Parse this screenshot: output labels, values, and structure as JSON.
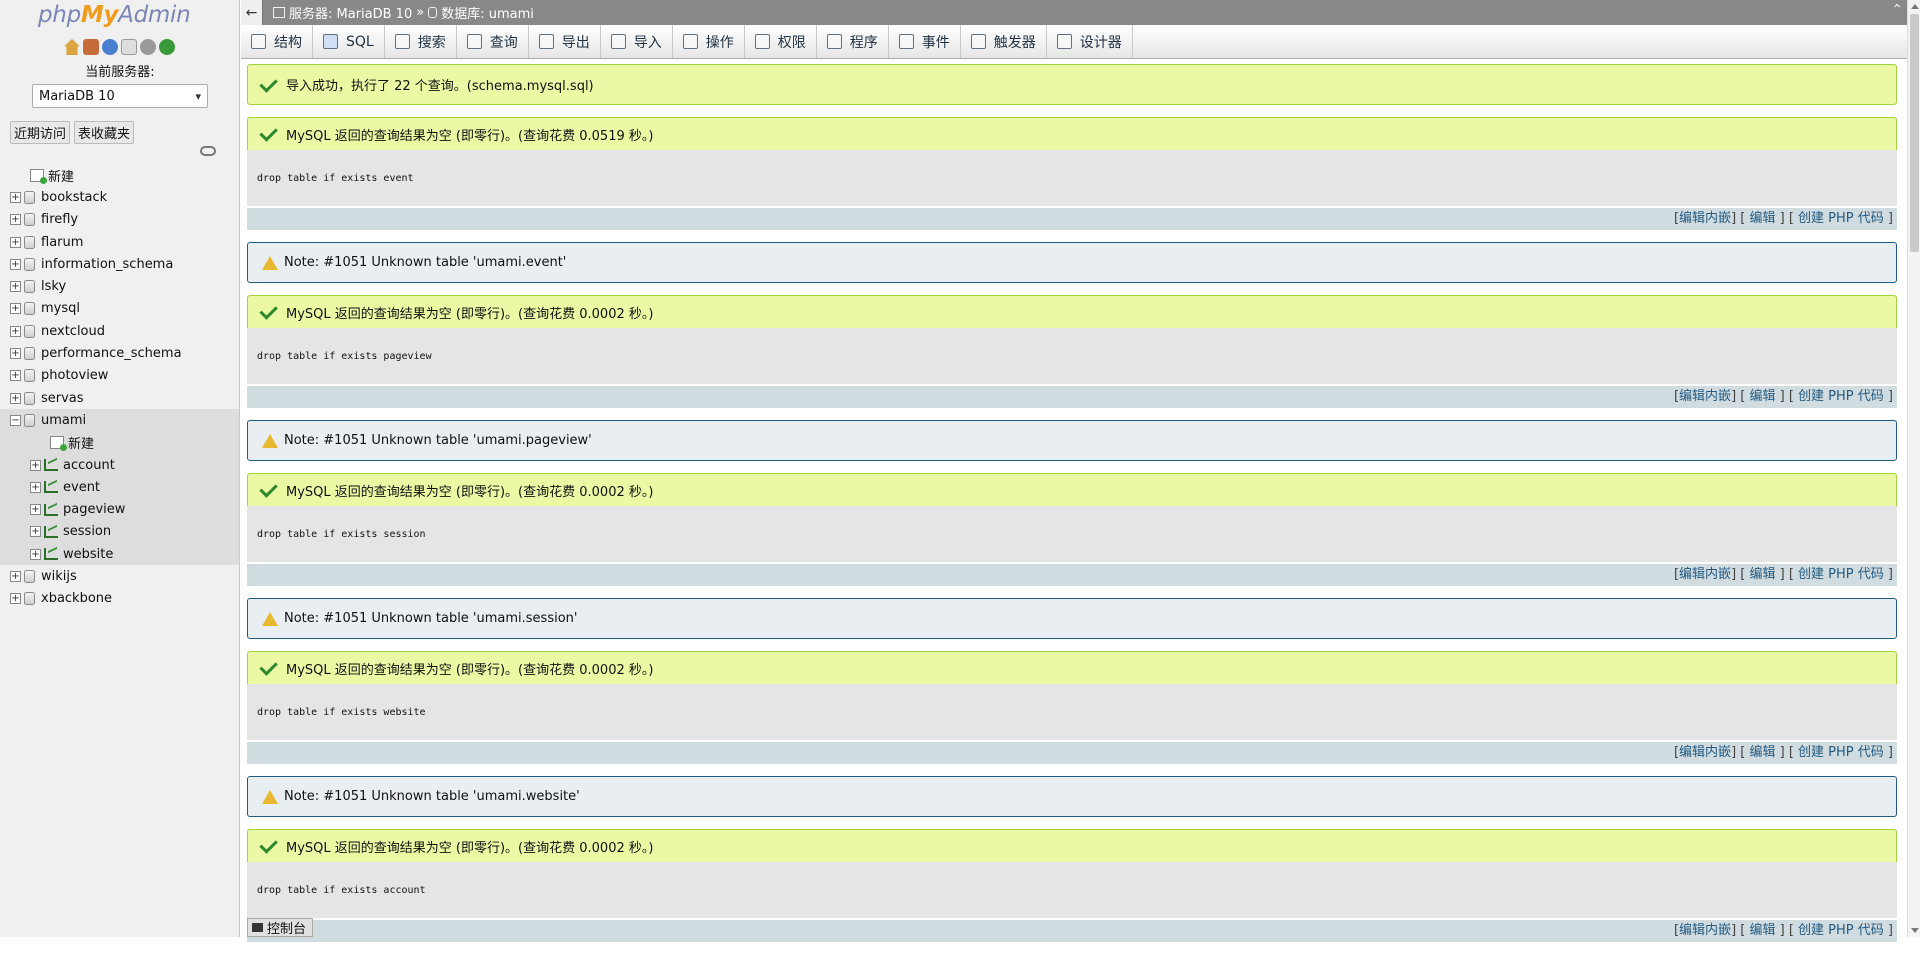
{
  "logo": {
    "php": "php",
    "my": "My",
    "admin": "Admin"
  },
  "sidebar": {
    "server_label": "当前服务器:",
    "server_value": "MariaDB 10",
    "tabs": [
      "近期访问",
      "表收藏夹"
    ],
    "tree": [
      {
        "label": "新建",
        "type": "new"
      },
      {
        "label": "bookstack",
        "type": "db"
      },
      {
        "label": "firefly",
        "type": "db"
      },
      {
        "label": "flarum",
        "type": "db"
      },
      {
        "label": "information_schema",
        "type": "db"
      },
      {
        "label": "lsky",
        "type": "db"
      },
      {
        "label": "mysql",
        "type": "db"
      },
      {
        "label": "nextcloud",
        "type": "db"
      },
      {
        "label": "performance_schema",
        "type": "db"
      },
      {
        "label": "photoview",
        "type": "db"
      },
      {
        "label": "servas",
        "type": "db"
      },
      {
        "label": "umami",
        "type": "db-open"
      },
      {
        "label": "新建",
        "type": "new-child"
      },
      {
        "label": "account",
        "type": "table"
      },
      {
        "label": "event",
        "type": "table"
      },
      {
        "label": "pageview",
        "type": "table"
      },
      {
        "label": "session",
        "type": "table"
      },
      {
        "label": "website",
        "type": "table"
      },
      {
        "label": "wikijs",
        "type": "db"
      },
      {
        "label": "xbackbone",
        "type": "db"
      }
    ]
  },
  "topbar": {
    "back_glyph": "←",
    "server_crumb": "服务器: MariaDB 10",
    "sep": "»",
    "db_crumb": "数据库: umami",
    "collapse_glyph": "⌃"
  },
  "menu": [
    "结构",
    "SQL",
    "搜索",
    "查询",
    "导出",
    "导入",
    "操作",
    "权限",
    "程序",
    "事件",
    "触发器",
    "设计器"
  ],
  "import_success": "导入成功，执行了 22 个查询。(schema.mysql.sql)",
  "results": [
    {
      "msg": "MySQL 返回的查询结果为空 (即零行)。(查询花费 0.0519 秒。)",
      "sql": "drop table if exists event",
      "note": "Note: #1051 Unknown table 'umami.event'"
    },
    {
      "msg": "MySQL 返回的查询结果为空 (即零行)。(查询花费 0.0002 秒。)",
      "sql": "drop table if exists pageview",
      "note": "Note: #1051 Unknown table 'umami.pageview'"
    },
    {
      "msg": "MySQL 返回的查询结果为空 (即零行)。(查询花费 0.0002 秒。)",
      "sql": "drop table if exists session",
      "note": "Note: #1051 Unknown table 'umami.session'"
    },
    {
      "msg": "MySQL 返回的查询结果为空 (即零行)。(查询花费 0.0002 秒。)",
      "sql": "drop table if exists website",
      "note": "Note: #1051 Unknown table 'umami.website'"
    },
    {
      "msg": "MySQL 返回的查询结果为空 (即零行)。(查询花费 0.0002 秒。)",
      "sql": "drop table if exists account",
      "note": ""
    }
  ],
  "result_links": {
    "inline_edit": "编辑内嵌",
    "edit": "编辑",
    "create_php": "创建 PHP 代码"
  },
  "console_label": "控制台"
}
